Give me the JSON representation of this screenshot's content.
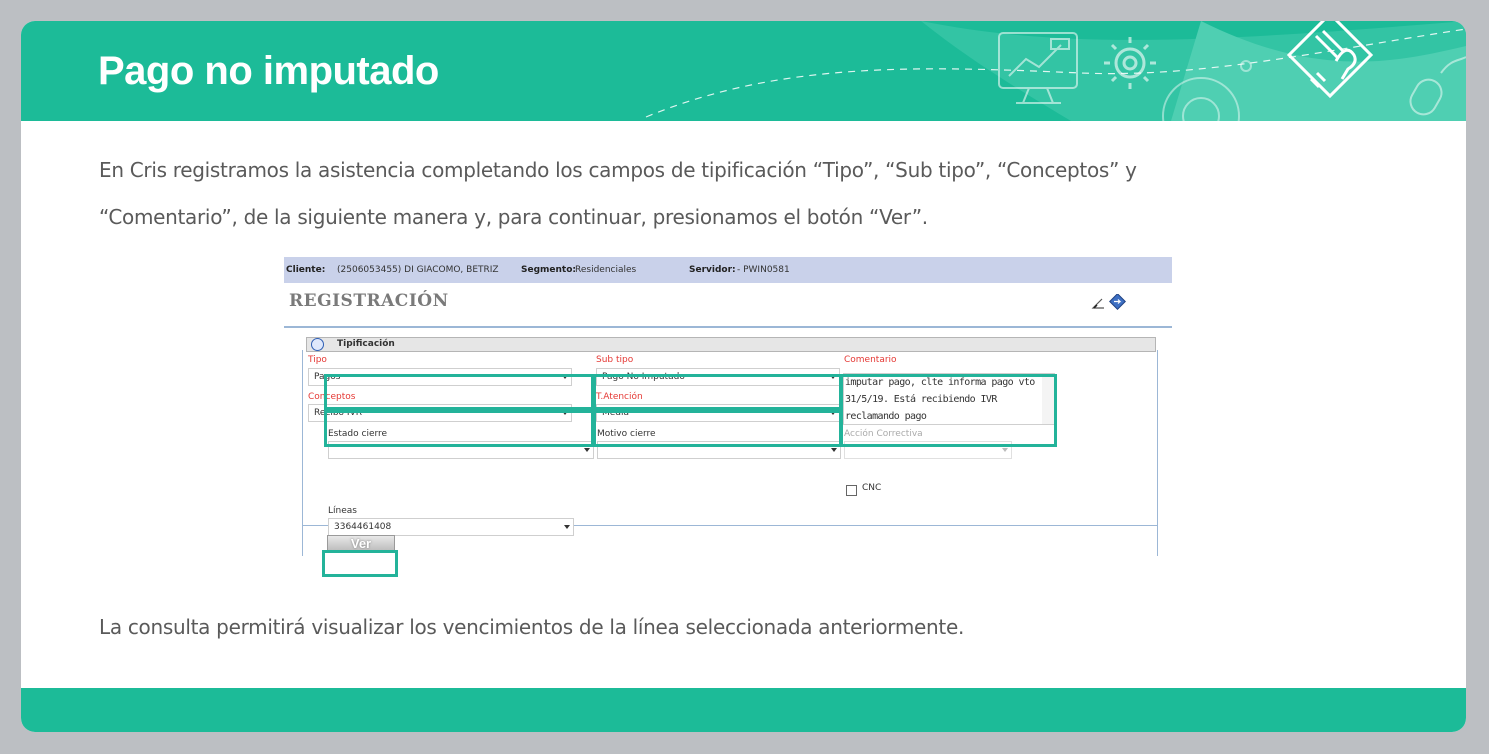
{
  "header": {
    "title": "Pago no imputado"
  },
  "intro": {
    "line1": "En Cris registramos la asistencia completando los campos de tipificación “Tipo”, “Sub tipo”, “Conceptos” y",
    "line2": "“Comentario”, de la siguiente manera y, para continuar, presionamos el botón “Ver”."
  },
  "screenshot": {
    "topbar": {
      "cliente_label": "Cliente:",
      "cliente_value": "(2506053455) DI GIACOMO, BETRIZ",
      "segmento_label": "Segmento:",
      "segmento_value": "Residenciales",
      "servidor_label": "Servidor:",
      "servidor_value": "- PWIN0581"
    },
    "section_title": "REGISTRACIÓN",
    "tipificacion_label": "Tipificación",
    "fields": {
      "tipo": {
        "label": "Tipo",
        "value": "Pagos"
      },
      "sub_tipo": {
        "label": "Sub tipo",
        "value": "Pago No Imputado"
      },
      "comentario": {
        "label": "Comentario",
        "value": "imputar pago, clte informa pago vto 31/5/19. Está recibiendo IVR reclamando pago"
      },
      "conceptos": {
        "label": "Conceptos",
        "value": "Recibo IVR"
      },
      "t_atencion": {
        "label": "T.Atención",
        "value": "Media"
      },
      "estado_cierre": {
        "label": "Estado cierre",
        "value": ""
      },
      "motivo_cierre": {
        "label": "Motivo cierre",
        "value": ""
      },
      "accion_correctiva": {
        "label": "Acción Correctiva",
        "value": ""
      },
      "cnc": {
        "label": "CNC"
      },
      "lineas": {
        "label": "Líneas",
        "value": "3364461408"
      }
    },
    "ver_button": "Ver"
  },
  "footer": {
    "text": "La consulta permitirá visualizar los vencimientos de la línea seleccionada anteriormente."
  },
  "colors": {
    "brand_green": "#1cbb98",
    "highlight": "#23b39a",
    "topbar": "#c9d1ea",
    "required_label": "#e53935"
  },
  "icons": [
    "monitor-chart-icon",
    "gear-icon",
    "hand-pencil-icon",
    "mouse-icon",
    "edit-icon",
    "diamond-arrow-icon"
  ]
}
